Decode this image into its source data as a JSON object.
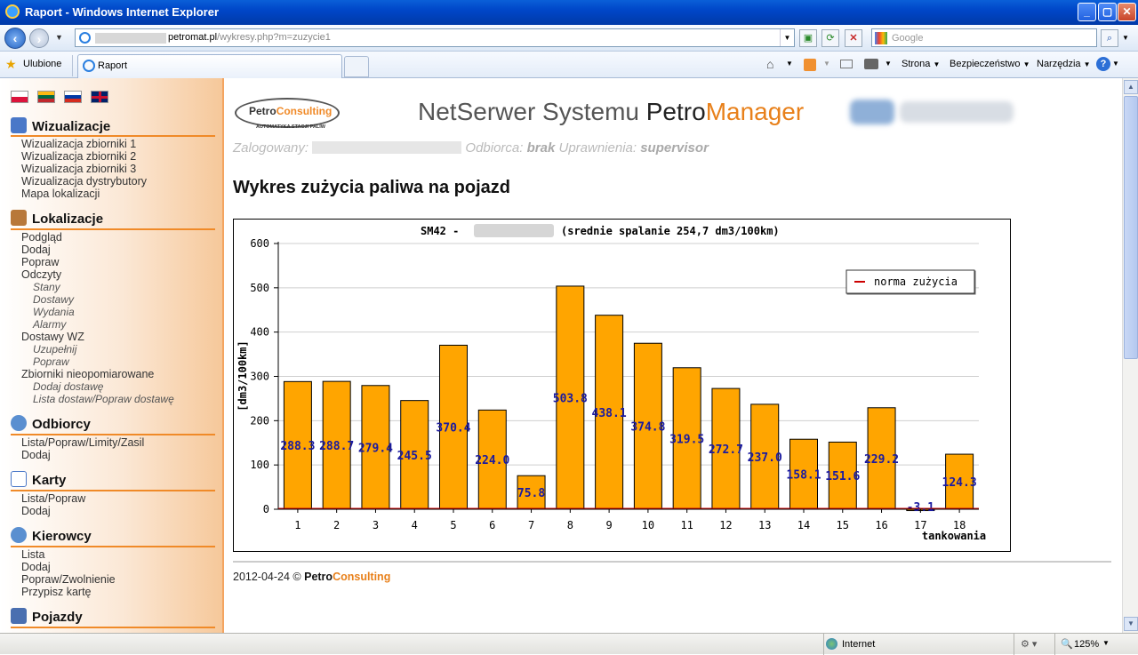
{
  "window": {
    "title": "Raport - Windows Internet Explorer"
  },
  "address": {
    "domain": "petromat.pl",
    "path": "/wykresy.php?m=zuzycie1"
  },
  "search": {
    "placeholder": "Google"
  },
  "favorites": {
    "label": "Ulubione"
  },
  "tab": {
    "title": "Raport"
  },
  "commandbar": {
    "page": "Strona",
    "safety": "Bezpieczeństwo",
    "tools": "Narzędzia"
  },
  "sidebar": {
    "sections": [
      {
        "title": "Wizualizacje",
        "items": [
          "Wizualizacja zbiorniki 1",
          "Wizualizacja zbiorniki 2",
          "Wizualizacja zbiorniki 3",
          "Wizualizacja dystrybutory",
          "Mapa lokalizacji"
        ]
      },
      {
        "title": "Lokalizacje",
        "items": [
          "Podgląd",
          "Dodaj",
          "Popraw",
          "Odczyty"
        ],
        "subitems_odczyty": [
          "Stany",
          "Dostawy",
          "Wydania",
          "Alarmy"
        ],
        "item_wz": "Dostawy WZ",
        "subitems_wz": [
          "Uzupełnij",
          "Popraw"
        ],
        "item_zb": "Zbiorniki nieopomiarowane",
        "subitems_zb": [
          "Dodaj dostawę",
          "Lista dostaw/Popraw dostawę"
        ]
      },
      {
        "title": "Odbiorcy",
        "items": [
          "Lista/Popraw/Limity/Zasil",
          "Dodaj"
        ]
      },
      {
        "title": "Karty",
        "items": [
          "Lista/Popraw",
          "Dodaj"
        ]
      },
      {
        "title": "Kierowcy",
        "items": [
          "Lista",
          "Dodaj",
          "Popraw/Zwolnienie",
          "Przypisz kartę"
        ]
      },
      {
        "title": "Pojazdy",
        "items": []
      }
    ]
  },
  "header": {
    "logo_petro": "Petro",
    "logo_consulting": "Consulting",
    "logo_slogan": "AUTOMATYKA STACJI PALIW",
    "title_part1": "NetSerwer Systemu ",
    "title_part2": "Petro",
    "title_part3": "Manager",
    "user_label": "Zalogowany:",
    "recipient_label": "Odbiorca:",
    "recipient_value": "brak",
    "perm_label": "Uprawnienia:",
    "perm_value": "supervisor"
  },
  "page": {
    "title": "Wykres zużycia paliwa na pojazd"
  },
  "chart_data": {
    "type": "bar",
    "title_prefix": "SM42 - ",
    "title_suffix": "(srednie spalanie 254,7 dm3/100km)",
    "xlabel": "tankowania",
    "ylabel": "[dm3/100km]",
    "ylim": [
      0,
      600
    ],
    "yticks": [
      0,
      100,
      200,
      300,
      400,
      500,
      600
    ],
    "categories": [
      "1",
      "2",
      "3",
      "4",
      "5",
      "6",
      "7",
      "8",
      "9",
      "10",
      "11",
      "12",
      "13",
      "14",
      "15",
      "16",
      "17",
      "18"
    ],
    "values": [
      288.3,
      288.7,
      279.4,
      245.5,
      370.4,
      224.0,
      75.8,
      503.8,
      438.1,
      374.8,
      319.5,
      272.7,
      237.0,
      158.1,
      151.6,
      229.2,
      -3.1,
      124.3
    ],
    "labels": [
      "288.3",
      "288.7",
      "279.4",
      "245.5",
      "370.4",
      "224.0",
      "75.8",
      "503.8",
      "438.1",
      "374.8",
      "319.5",
      "272.7",
      "237.0",
      "158.1",
      "151.6",
      "229.2",
      "-3.1",
      "124.3"
    ],
    "legend": [
      "norma zużycia"
    ],
    "legend_position": "top-right",
    "grid": true,
    "colors": {
      "bar": "#ffa500",
      "label": "#1a1aa0",
      "norm": "#cc0000"
    }
  },
  "footer": {
    "date": "2012-04-24 ©",
    "petro": "Petro",
    "consulting": "Consulting"
  },
  "status": {
    "zone": "Internet",
    "zoom": "125%"
  }
}
